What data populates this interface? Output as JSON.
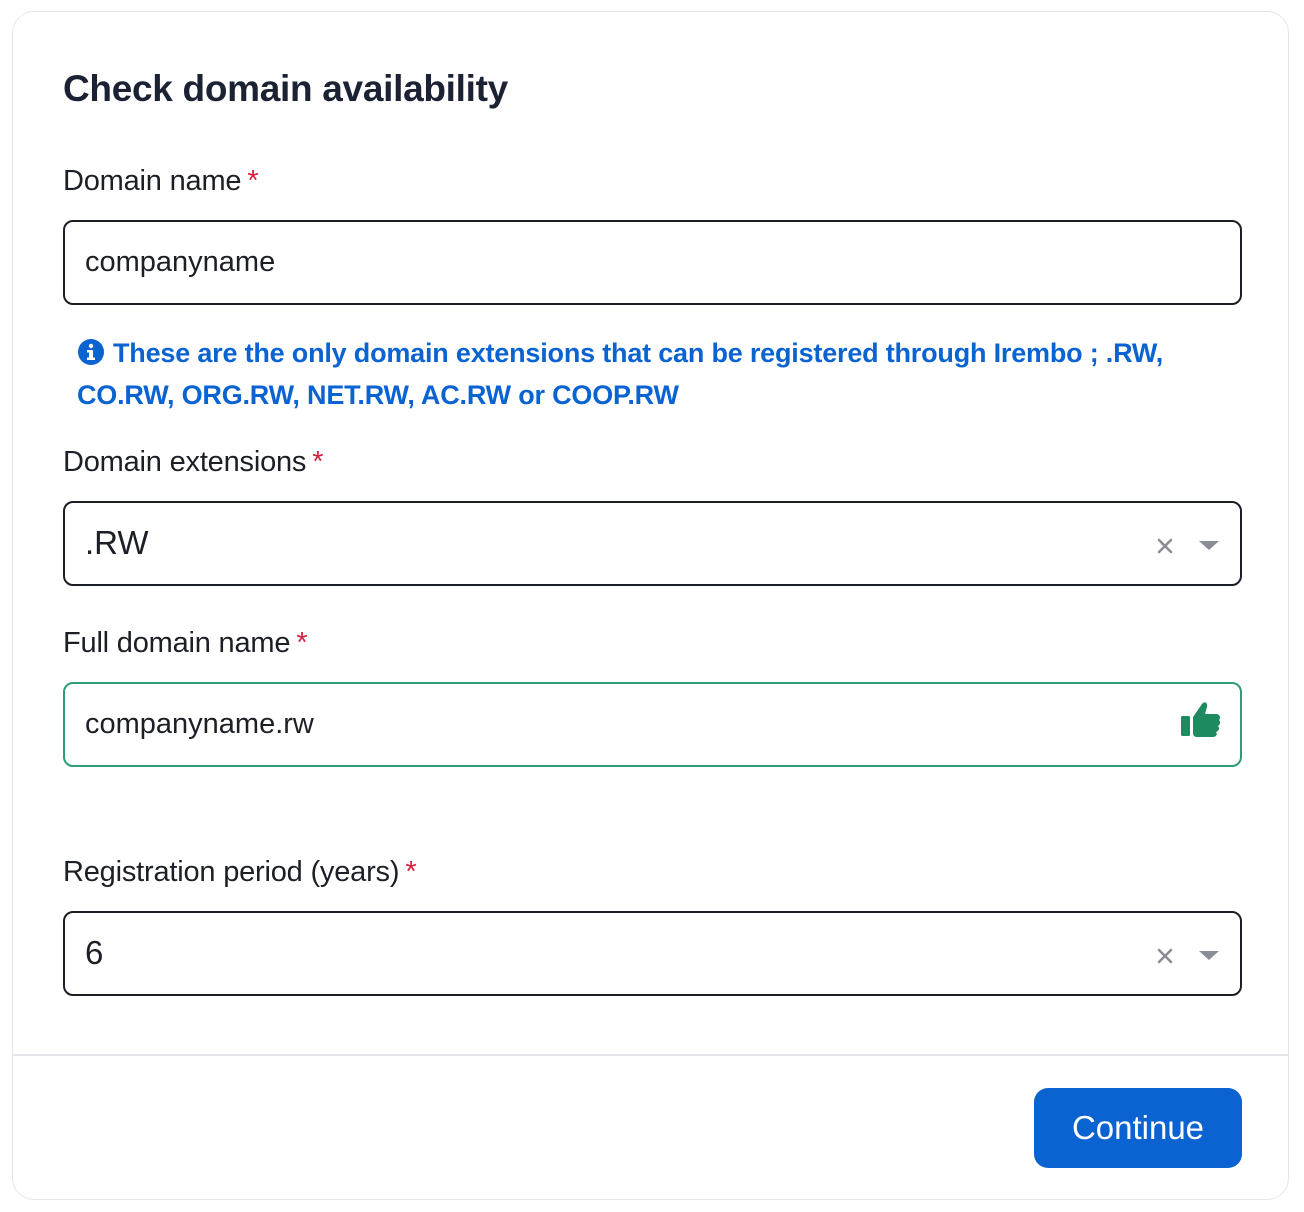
{
  "form": {
    "title": "Check domain availability",
    "required_marker": "*",
    "domain_name": {
      "label": "Domain name",
      "value": "companyname"
    },
    "info_note": "These are the only domain extensions that can be registered through Irembo ; .RW, CO.RW, ORG.RW, NET.RW, AC.RW or COOP.RW",
    "domain_extension": {
      "label": "Domain extensions",
      "selected": ".RW"
    },
    "full_domain_name": {
      "label": "Full domain name",
      "value": "companyname.rw",
      "status_icon": "thumbs-up-icon"
    },
    "registration_period": {
      "label": "Registration period (years)",
      "selected": "6"
    },
    "continue_label": "Continue"
  },
  "colors": {
    "accent": "#0a63d1",
    "required": "#d8203d",
    "valid": "#2e9c78",
    "border": "#1c1f26"
  }
}
